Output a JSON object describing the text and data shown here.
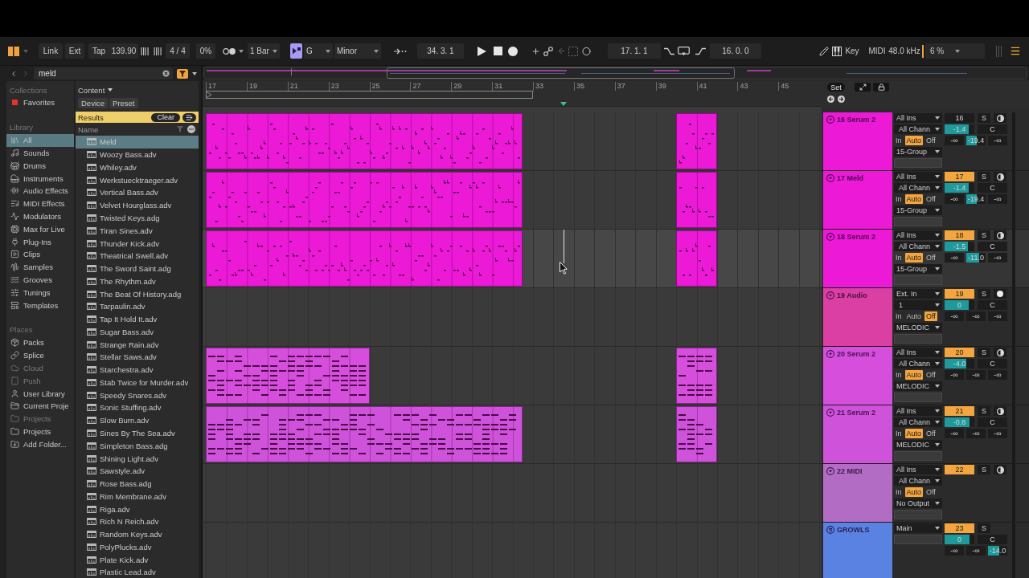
{
  "toolbar": {
    "link": "Link",
    "ext": "Ext",
    "tap": "Tap",
    "tempo": "139.90",
    "time_signature": "4 / 4",
    "groove_amount": "0%",
    "quantization": "1 Bar",
    "scale_mode_on": true,
    "root_note": "G",
    "scale": "Minor",
    "position": "34. 3. 1",
    "loop_start": "17. 1. 1",
    "loop_length": "16. 0. 0",
    "key_map": "Key",
    "midi_map": "MIDI",
    "sample_rate": "48.0 kHz",
    "cpu_load": "6 %"
  },
  "browser": {
    "search": {
      "value": "meld"
    },
    "collections": {
      "title": "Collections",
      "items": [
        {
          "label": "Favorites",
          "color": "#e5302b"
        }
      ]
    },
    "library": {
      "title": "Library",
      "items": [
        {
          "label": "All",
          "kind": "all",
          "selected": true
        },
        {
          "label": "Sounds",
          "kind": "sounds",
          "selected": false
        },
        {
          "label": "Drums",
          "kind": "drums",
          "selected": false
        },
        {
          "label": "Instruments",
          "kind": "instruments",
          "selected": false
        },
        {
          "label": "Audio Effects",
          "kind": "audio_effects",
          "selected": false
        },
        {
          "label": "MIDI Effects",
          "kind": "midi_effects",
          "selected": false
        },
        {
          "label": "Modulators",
          "kind": "modulators",
          "selected": false
        },
        {
          "label": "Max for Live",
          "kind": "max_for_live",
          "selected": false
        },
        {
          "label": "Plug-Ins",
          "kind": "plugins",
          "selected": false
        },
        {
          "label": "Clips",
          "kind": "clips",
          "selected": false
        },
        {
          "label": "Samples",
          "kind": "samples",
          "selected": false
        },
        {
          "label": "Grooves",
          "kind": "grooves",
          "selected": false
        },
        {
          "label": "Tunings",
          "kind": "tunings",
          "selected": false
        },
        {
          "label": "Templates",
          "kind": "templates",
          "selected": false
        }
      ]
    },
    "places": {
      "title": "Places",
      "items": [
        {
          "label": "Packs",
          "kind": "packs",
          "disabled": false
        },
        {
          "label": "Splice",
          "kind": "splice",
          "disabled": false
        },
        {
          "label": "Cloud",
          "kind": "cloud",
          "disabled": true
        },
        {
          "label": "Push",
          "kind": "push",
          "disabled": true
        },
        {
          "label": "User Library",
          "kind": "user_library",
          "disabled": false
        },
        {
          "label": "Current Proje",
          "kind": "current_project",
          "disabled": false
        },
        {
          "label": "Projects",
          "kind": "folder",
          "disabled": true
        },
        {
          "label": "Projects",
          "kind": "folder",
          "disabled": false
        },
        {
          "label": "Add Folder...",
          "kind": "add_folder",
          "disabled": false
        }
      ]
    },
    "filters": {
      "content": "Content",
      "tags": [
        "Device",
        "Preset"
      ]
    },
    "results": {
      "title": "Results",
      "clear": "Clear",
      "column": "Name",
      "items": [
        {
          "label": "Meld",
          "selected": true
        },
        {
          "label": "Woozy Bass.adv",
          "selected": false
        },
        {
          "label": "Whiley.adv",
          "selected": false
        },
        {
          "label": "Werkstuecktraeger.adv",
          "selected": false
        },
        {
          "label": "Vertical Bass.adv",
          "selected": false
        },
        {
          "label": "Velvet Hourglass.adv",
          "selected": false
        },
        {
          "label": "Twisted Keys.adg",
          "selected": false
        },
        {
          "label": "Tiran Sines.adv",
          "selected": false
        },
        {
          "label": "Thunder Kick.adv",
          "selected": false
        },
        {
          "label": "Theatrical Swell.adv",
          "selected": false
        },
        {
          "label": "The Sword Saint.adg",
          "selected": false
        },
        {
          "label": "The Rhythm.adv",
          "selected": false
        },
        {
          "label": "The Beat Of History.adg",
          "selected": false
        },
        {
          "label": "Tarpaulin.adv",
          "selected": false
        },
        {
          "label": "Tap It Hold It.adv",
          "selected": false
        },
        {
          "label": "Sugar Bass.adv",
          "selected": false
        },
        {
          "label": "Strange Rain.adv",
          "selected": false
        },
        {
          "label": "Stellar Saws.adv",
          "selected": false
        },
        {
          "label": "Starchestra.adv",
          "selected": false
        },
        {
          "label": "Stab Twice for Murder.adv",
          "selected": false
        },
        {
          "label": "Speedy Snares.adv",
          "selected": false
        },
        {
          "label": "Sonic Stuffing.adv",
          "selected": false
        },
        {
          "label": "Slow Burn.adv",
          "selected": false
        },
        {
          "label": "Sines By The Sea.adv",
          "selected": false
        },
        {
          "label": "Simpleton Bass.adg",
          "selected": false
        },
        {
          "label": "Shining Light.adv",
          "selected": false
        },
        {
          "label": "Sawstyle.adv",
          "selected": false
        },
        {
          "label": "Rose Bass.adg",
          "selected": false
        },
        {
          "label": "Rim Membrane.adv",
          "selected": false
        },
        {
          "label": "Riga.adv",
          "selected": false
        },
        {
          "label": "Rich N Reich.adv",
          "selected": false
        },
        {
          "label": "Random Keys.adv",
          "selected": false
        },
        {
          "label": "PolyPlucks.adv",
          "selected": false
        },
        {
          "label": "Plate Kick.adv",
          "selected": false
        },
        {
          "label": "Plastic Lead.adv",
          "selected": false
        }
      ]
    }
  },
  "ruler": [
    "17",
    "19",
    "21",
    "23",
    "25",
    "27",
    "29",
    "31",
    "33",
    "35",
    "37",
    "39",
    "41",
    "43",
    "45"
  ],
  "mixer": {
    "set": "Set"
  },
  "tracks": [
    {
      "name": "16 Serum 2",
      "kind": "midi",
      "color": "#ec19d7",
      "selected": false,
      "clips": [
        {
          "kind": "midi"
        },
        {
          "kind": "midi"
        }
      ],
      "input": "All Ins",
      "input_channel": "All Chann",
      "monitor": [
        {
          "label": "In",
          "selected": false
        },
        {
          "label": "Auto",
          "selected": true
        },
        {
          "label": "Off",
          "selected": false
        }
      ],
      "output": "15-Group",
      "number": "16",
      "active": false,
      "solo": "S",
      "volume": {
        "value": "-1.4",
        "level": 0.8
      },
      "pan": "C",
      "sends": [
        {
          "value": "-∞"
        },
        {
          "value": "-19.4",
          "level": 0.55
        },
        {
          "value": "-∞"
        }
      ]
    },
    {
      "name": "17 Meld",
      "kind": "midi",
      "color": "#ec19d7",
      "selected": false,
      "clips": [
        {
          "kind": "midi"
        },
        {
          "kind": "midi"
        }
      ],
      "input": "All Ins",
      "input_channel": "All Chann",
      "monitor": [
        {
          "label": "In",
          "selected": false
        },
        {
          "label": "Auto",
          "selected": true
        },
        {
          "label": "Off",
          "selected": false
        }
      ],
      "output": "15-Group",
      "number": "17",
      "active": true,
      "solo": "S",
      "volume": {
        "value": "-1.4",
        "level": 0.8
      },
      "pan": "C",
      "sends": [
        {
          "value": "-∞"
        },
        {
          "value": "-19.4",
          "level": 0.55
        },
        {
          "value": "-∞"
        }
      ]
    },
    {
      "name": "18 Serum 2",
      "kind": "midi",
      "color": "#ec19d7",
      "selected": true,
      "clips": [
        {
          "kind": "midi"
        },
        {
          "kind": "midi"
        }
      ],
      "input": "All Ins",
      "input_channel": "All Chann",
      "monitor": [
        {
          "label": "In",
          "selected": false
        },
        {
          "label": "Auto",
          "selected": true
        },
        {
          "label": "Off",
          "selected": false
        }
      ],
      "output": "15-Group",
      "number": "18",
      "active": true,
      "solo": "S",
      "volume": {
        "value": "-1.5",
        "level": 0.78
      },
      "pan": "C",
      "sends": [
        {
          "value": "-∞"
        },
        {
          "value": "-11.0",
          "level": 0.65
        },
        {
          "value": "-∞"
        }
      ]
    },
    {
      "name": "19 Audio",
      "kind": "audio",
      "color": "#dc3fa3",
      "selected": false,
      "input": "Ext. In",
      "input_channel": "1",
      "monitor": [
        {
          "label": "In",
          "selected": false
        },
        {
          "label": "Auto",
          "selected": false
        },
        {
          "label": "Off",
          "selected": true
        }
      ],
      "output": "MELODIC",
      "number": "19",
      "active": true,
      "solo": "S",
      "volume": {
        "value": "0",
        "level": 0.82
      },
      "pan": "C",
      "sends": [
        {
          "value": "-∞"
        },
        {
          "value": "-∞"
        },
        {
          "value": "-∞"
        }
      ]
    },
    {
      "name": "20 Serum 2",
      "kind": "midi",
      "color": "#d64fdc",
      "selected": false,
      "clips": [
        {
          "kind": "midi"
        },
        {
          "kind": "midi"
        }
      ],
      "input": "All Ins",
      "input_channel": "All Chann",
      "monitor": [
        {
          "label": "In",
          "selected": false
        },
        {
          "label": "Auto",
          "selected": true
        },
        {
          "label": "Off",
          "selected": false
        }
      ],
      "output": "MELODIC",
      "number": "20",
      "active": true,
      "solo": "S",
      "volume": {
        "value": "-4.0",
        "level": 0.74
      },
      "pan": "C",
      "sends": [
        {
          "value": "-∞"
        },
        {
          "value": "-∞"
        },
        {
          "value": "-∞"
        }
      ]
    },
    {
      "name": "21 Serum 2",
      "kind": "midi",
      "color": "#cf52db",
      "selected": false,
      "clips": [
        {
          "kind": "midi"
        },
        {
          "kind": "midi"
        }
      ],
      "input": "All Ins",
      "input_channel": "All Chann",
      "monitor": [
        {
          "label": "In",
          "selected": false
        },
        {
          "label": "Auto",
          "selected": true
        },
        {
          "label": "Off",
          "selected": false
        }
      ],
      "output": "MELODIC",
      "number": "21",
      "active": true,
      "solo": "S",
      "volume": {
        "value": "-0.8",
        "level": 0.83
      },
      "pan": "C",
      "sends": [
        {
          "value": "-∞"
        },
        {
          "value": "-∞"
        },
        {
          "value": "-∞"
        }
      ]
    },
    {
      "name": "22 MIDI",
      "kind": "midi",
      "color": "#b36cc3",
      "selected": false,
      "input": "All Ins",
      "input_channel": "All Chann",
      "monitor": [
        {
          "label": "In",
          "selected": false
        },
        {
          "label": "Auto",
          "selected": true
        },
        {
          "label": "Off",
          "selected": false
        }
      ],
      "output": "No Output",
      "number": "22",
      "active": true,
      "solo": "S"
    },
    {
      "name": "GROWLS",
      "kind": "group",
      "color": "#5a82e2",
      "selected": false,
      "output": "Main",
      "number": "23",
      "active": true,
      "solo": "S",
      "volume": {
        "value": "0",
        "level": 0.85
      },
      "pan": "C",
      "sends": [
        {
          "value": "-∞"
        },
        {
          "value": "-∞"
        },
        {
          "value": "-14.0",
          "level": 0.6
        }
      ]
    }
  ]
}
